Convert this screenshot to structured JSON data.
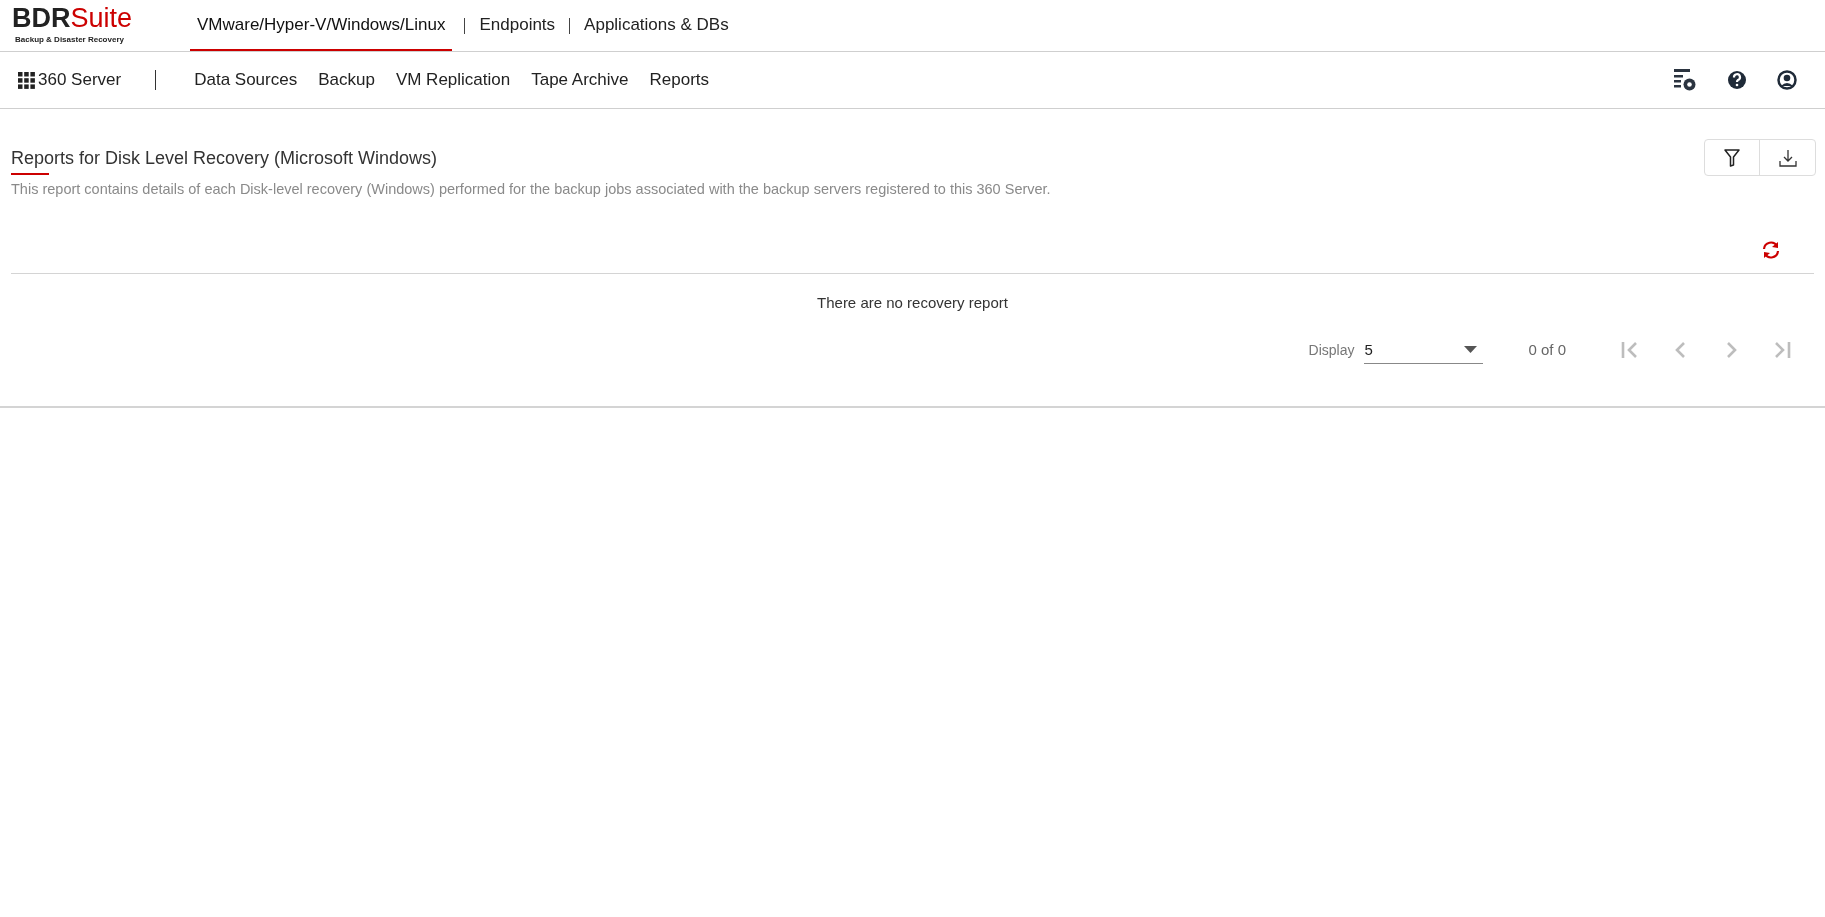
{
  "logo": {
    "primary": "BDR",
    "accent": "Suite",
    "tagline": "Backup & Disaster Recovery"
  },
  "top_tabs": [
    {
      "label": "VMware/Hyper-V/Windows/Linux",
      "selected": true
    },
    {
      "label": "Endpoints",
      "selected": false
    },
    {
      "label": "Applications & DBs",
      "selected": false
    }
  ],
  "sub_nav": {
    "home": "360 Server",
    "items": [
      "Data Sources",
      "Backup",
      "VM Replication",
      "Tape Archive",
      "Reports"
    ]
  },
  "report": {
    "title": "Reports for Disk Level Recovery (Microsoft Windows)",
    "description": "This report contains details of each Disk-level recovery (Windows) performed for the backup jobs associated with the backup servers registered to this 360 Server.",
    "empty_message": "There are no recovery report"
  },
  "pagination": {
    "display_label": "Display",
    "page_size": "5",
    "range": "0 of 0",
    "buttons": [
      {
        "kind": "first",
        "disabled": true
      },
      {
        "kind": "prev",
        "disabled": true
      },
      {
        "kind": "next",
        "disabled": true
      },
      {
        "kind": "last",
        "disabled": true
      }
    ]
  }
}
